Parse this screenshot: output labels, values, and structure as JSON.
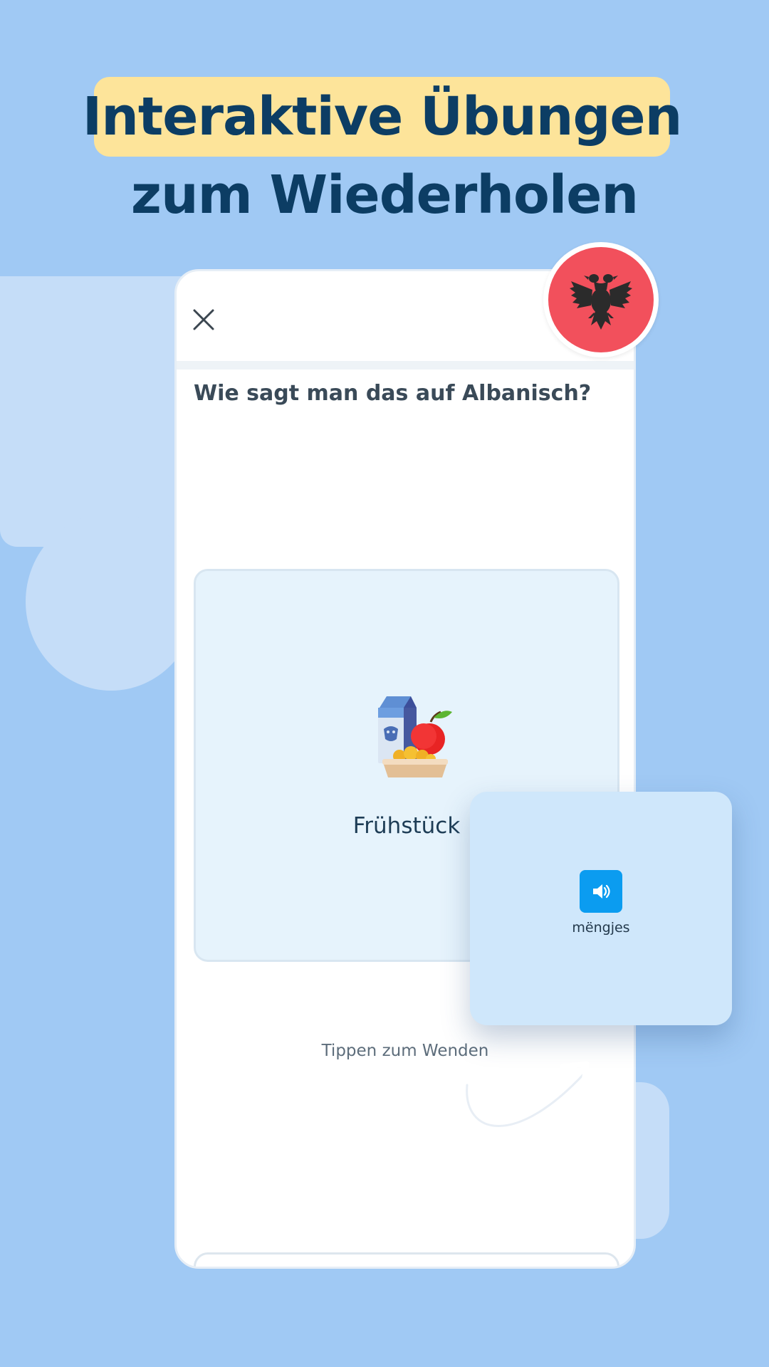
{
  "headline": {
    "line1": "Interaktive Übungen",
    "line2": "zum Wiederholen"
  },
  "exercise": {
    "close_icon": "close-icon",
    "prompt": "Wie sagt man das auf Albanisch?",
    "card_front": {
      "icon": "breakfast-icon",
      "word": "Frühstück"
    },
    "hint": "Tippen zum Wenden"
  },
  "flag": {
    "icon": "albania-flag-icon",
    "color": "#f2505c"
  },
  "card_back": {
    "audio_icon": "speaker-icon",
    "word": "mëngjes"
  },
  "colors": {
    "background": "#a0c9f4",
    "headline_text": "#0c3d64",
    "highlight": "#fde49a",
    "accent_blue": "#0b9cf0"
  }
}
